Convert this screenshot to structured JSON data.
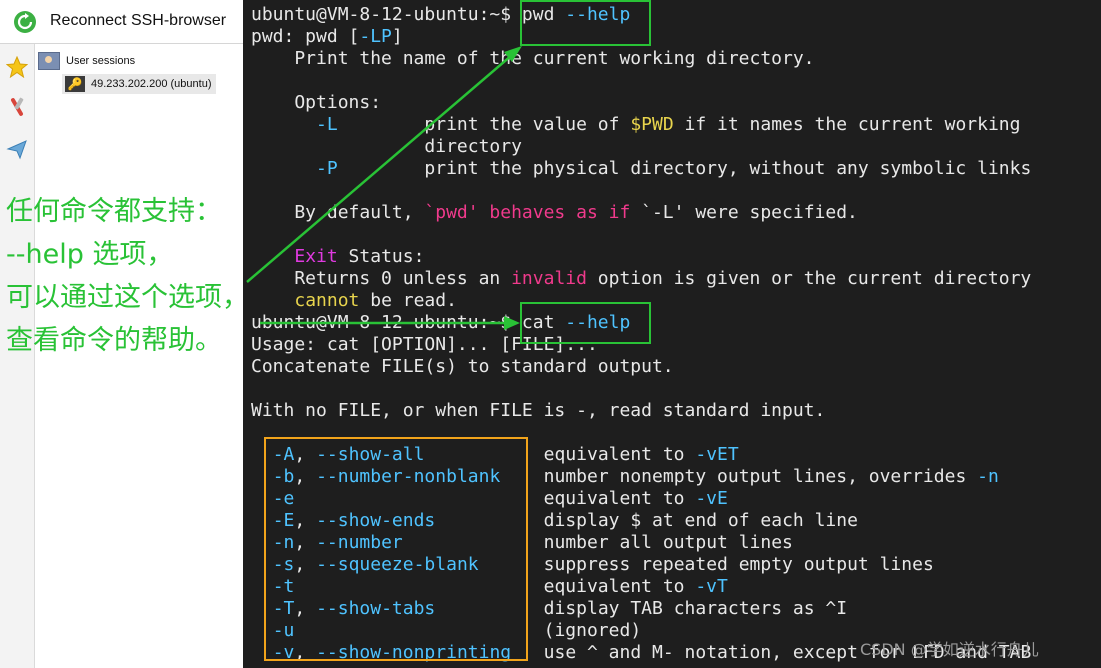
{
  "sessions_panel": {
    "reconnect_label": "Reconnect SSH-browser",
    "tree_root_label": "User sessions",
    "session_label": "49.233.202.200 (ubuntu)",
    "toolbar_icons": [
      "star-icon",
      "tools-icon",
      "send-icon"
    ]
  },
  "terminal": {
    "lines": [
      [
        {
          "t": "ubuntu@VM-8-12-ubuntu:~$ pwd "
        },
        {
          "t": "--help",
          "c": "blue"
        }
      ],
      [
        {
          "t": "pwd: pwd ["
        },
        {
          "t": "-LP",
          "c": "blue"
        },
        {
          "t": "]"
        }
      ],
      [
        {
          "t": "    Print the name of the current working directory."
        }
      ],
      [
        {
          "t": ""
        }
      ],
      [
        {
          "t": "    Options:"
        }
      ],
      [
        {
          "t": "      "
        },
        {
          "t": "-L",
          "c": "blue"
        },
        {
          "t": "        print the value of "
        },
        {
          "t": "$PWD",
          "c": "yellow"
        },
        {
          "t": " if it names the current working"
        }
      ],
      [
        {
          "t": "                directory"
        }
      ],
      [
        {
          "t": "      "
        },
        {
          "t": "-P",
          "c": "blue"
        },
        {
          "t": "        print the physical directory, without any symbolic links"
        }
      ],
      [
        {
          "t": ""
        }
      ],
      [
        {
          "t": "    By default, "
        },
        {
          "t": "`pwd' behaves as if",
          "c": "pink"
        },
        {
          "t": " `-L' were specified."
        }
      ],
      [
        {
          "t": ""
        }
      ],
      [
        {
          "t": "    "
        },
        {
          "t": "Exit",
          "c": "magenta"
        },
        {
          "t": " Status:"
        }
      ],
      [
        {
          "t": "    Returns 0 unless an "
        },
        {
          "t": "invalid",
          "c": "pink"
        },
        {
          "t": " option is given or the current directory"
        }
      ],
      [
        {
          "t": "    "
        },
        {
          "t": "cannot",
          "c": "yellow"
        },
        {
          "t": " be read."
        }
      ],
      [
        {
          "t": "ubuntu@VM-8-12-ubuntu:~$ cat "
        },
        {
          "t": "--help",
          "c": "blue"
        }
      ],
      [
        {
          "t": "Usage: cat [OPTION]... [FILE]..."
        }
      ],
      [
        {
          "t": "Concatenate FILE(s) to standard output."
        }
      ],
      [
        {
          "t": ""
        }
      ],
      [
        {
          "t": "With no FILE, or when FILE is -, read standard input."
        }
      ],
      [
        {
          "t": ""
        }
      ],
      [
        {
          "t": "  "
        },
        {
          "t": "-A",
          "c": "blue"
        },
        {
          "t": ", "
        },
        {
          "t": "--show-all",
          "c": "blue"
        },
        {
          "t": "           equivalent to "
        },
        {
          "t": "-vET",
          "c": "blue"
        }
      ],
      [
        {
          "t": "  "
        },
        {
          "t": "-b",
          "c": "blue"
        },
        {
          "t": ", "
        },
        {
          "t": "--number-nonblank",
          "c": "blue"
        },
        {
          "t": "    number nonempty output lines, overrides "
        },
        {
          "t": "-n",
          "c": "blue"
        }
      ],
      [
        {
          "t": "  "
        },
        {
          "t": "-e",
          "c": "blue"
        },
        {
          "t": "                       equivalent to "
        },
        {
          "t": "-vE",
          "c": "blue"
        }
      ],
      [
        {
          "t": "  "
        },
        {
          "t": "-E",
          "c": "blue"
        },
        {
          "t": ", "
        },
        {
          "t": "--show-ends",
          "c": "blue"
        },
        {
          "t": "          display $ at end of each line"
        }
      ],
      [
        {
          "t": "  "
        },
        {
          "t": "-n",
          "c": "blue"
        },
        {
          "t": ", "
        },
        {
          "t": "--number",
          "c": "blue"
        },
        {
          "t": "             number all output lines"
        }
      ],
      [
        {
          "t": "  "
        },
        {
          "t": "-s",
          "c": "blue"
        },
        {
          "t": ", "
        },
        {
          "t": "--squeeze-blank",
          "c": "blue"
        },
        {
          "t": "      suppress repeated empty output lines"
        }
      ],
      [
        {
          "t": "  "
        },
        {
          "t": "-t",
          "c": "blue"
        },
        {
          "t": "                       equivalent to "
        },
        {
          "t": "-vT",
          "c": "blue"
        }
      ],
      [
        {
          "t": "  "
        },
        {
          "t": "-T",
          "c": "blue"
        },
        {
          "t": ", "
        },
        {
          "t": "--show-tabs",
          "c": "blue"
        },
        {
          "t": "          display TAB characters as ^I"
        }
      ],
      [
        {
          "t": "  "
        },
        {
          "t": "-u",
          "c": "blue"
        },
        {
          "t": "                       (ignored)"
        }
      ],
      [
        {
          "t": "  "
        },
        {
          "t": "-v",
          "c": "blue"
        },
        {
          "t": ", "
        },
        {
          "t": "--show-nonprinting",
          "c": "blue"
        },
        {
          "t": "   use ^ and M- notation, except for LFD and TAB"
        }
      ]
    ]
  },
  "annotation": {
    "lines": [
      "任何命令都支持：",
      "--help 选项，",
      "可以通过这个选项，",
      "查看命令的帮助。"
    ]
  },
  "watermark": "CSDN @学如逆水行舟儿",
  "colors": {
    "terminal_bg": "#1e1e1e",
    "terminal_fg": "#e8e8e8",
    "option_blue": "#4fc3ff",
    "variable_yellow": "#e8d44d",
    "string_pink": "#f03a8c",
    "keyword_magenta": "#e03ae0",
    "annotation_green": "#29c236",
    "highlight_orange": "#f2a41b"
  }
}
